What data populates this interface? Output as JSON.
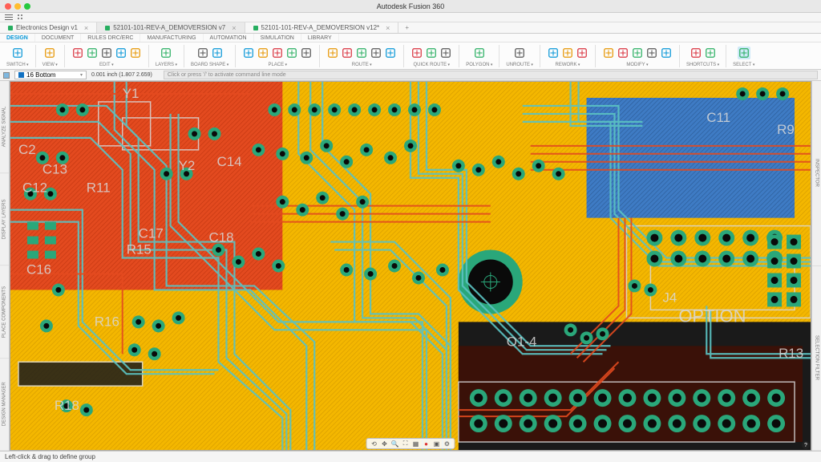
{
  "app": {
    "title": "Autodesk Fusion 360"
  },
  "documentTabs": [
    {
      "icon_color": "#27ae60",
      "label": "Electronics Design v1",
      "active": false
    },
    {
      "icon_color": "#27ae60",
      "label": "52101-101-REV-A_DEMOVERSION v7",
      "active": true
    },
    {
      "icon_color": "#27ae60",
      "label": "52101-101-REV-A_DEMOVERSION v12*",
      "active": false
    }
  ],
  "ribbonTabs": [
    "DESIGN",
    "DOCUMENT",
    "RULES DRC/ERC",
    "MANUFACTURING",
    "AUTOMATION",
    "SIMULATION",
    "LIBRARY"
  ],
  "toolbar": {
    "groups": [
      {
        "label": "SWITCH",
        "icons": [
          "switch-pcb-icon"
        ]
      },
      {
        "label": "VIEW",
        "icons": [
          "view-2d-icon"
        ]
      },
      {
        "label": "EDIT",
        "icons": [
          "move-icon",
          "name-icon",
          "delete-icon",
          "check-icon",
          "lock-icon"
        ]
      },
      {
        "label": "LAYERS",
        "icons": [
          "layers-icon"
        ]
      },
      {
        "label": "BOARD SHAPE",
        "icons": [
          "outline-icon",
          "derive-icon"
        ]
      },
      {
        "label": "PLACE",
        "icons": [
          "component-icon",
          "via-icon",
          "hole-icon",
          "text-icon",
          "line-icon"
        ]
      },
      {
        "label": "ROUTE",
        "icons": [
          "route-icon",
          "ripup-icon",
          "fanout-icon",
          "diff-icon",
          "meander-icon"
        ]
      },
      {
        "label": "QUICK ROUTE",
        "icons": [
          "qr1-icon",
          "qr2-icon",
          "qr3-icon"
        ]
      },
      {
        "label": "POLYGON",
        "icons": [
          "poly-icon"
        ]
      },
      {
        "label": "UNROUTE",
        "icons": [
          "unroute-icon"
        ]
      },
      {
        "label": "REWORK",
        "icons": [
          "slice-icon",
          "corner-icon",
          "mirror-icon"
        ]
      },
      {
        "label": "MODIFY",
        "icons": [
          "array-icon",
          "align-icon",
          "move2-icon",
          "rotate-icon",
          "scale-icon"
        ]
      },
      {
        "label": "SHORTCUTS",
        "icons": [
          "hash-icon",
          "grid-icon"
        ]
      },
      {
        "label": "SELECT",
        "icons": [
          "cursor-icon"
        ]
      }
    ]
  },
  "layerBar": {
    "current_layer": "16 Bottom",
    "grid_readout": "0.001 inch (1.807 2.659)",
    "command_hint": "Click or press '/' to activate command line mode"
  },
  "leftTabs": [
    "ANALYZE SIGNAL",
    "DISPLAY LAYERS",
    "PLACE COMPONENTS",
    "DESIGN MANAGER"
  ],
  "rightTabs": [
    "INSPECTOR",
    "SELECTION FILTER"
  ],
  "statusbar": {
    "hint": "Left-click & drag to define group"
  },
  "silkscreen": [
    "Y1",
    "C2",
    "C13",
    "C12",
    "R11",
    "Y2",
    "C14",
    "C17",
    "C18",
    "R15",
    "C16",
    "R16",
    "R18",
    "C11",
    "R9",
    "R13",
    "J4",
    "OPTION",
    "O1-4"
  ],
  "colors": {
    "accent": "#0696d7",
    "pcb_copper_top": "#e34a1f",
    "pcb_copper_inner": "#f4b700",
    "pcb_copper_bottom": "#5bc2c2",
    "pcb_plane": "#3e7bc4",
    "pcb_pad": "#2aa77a",
    "pcb_drill": "#0a0a0a",
    "pcb_silk": "#d8d8d8"
  }
}
